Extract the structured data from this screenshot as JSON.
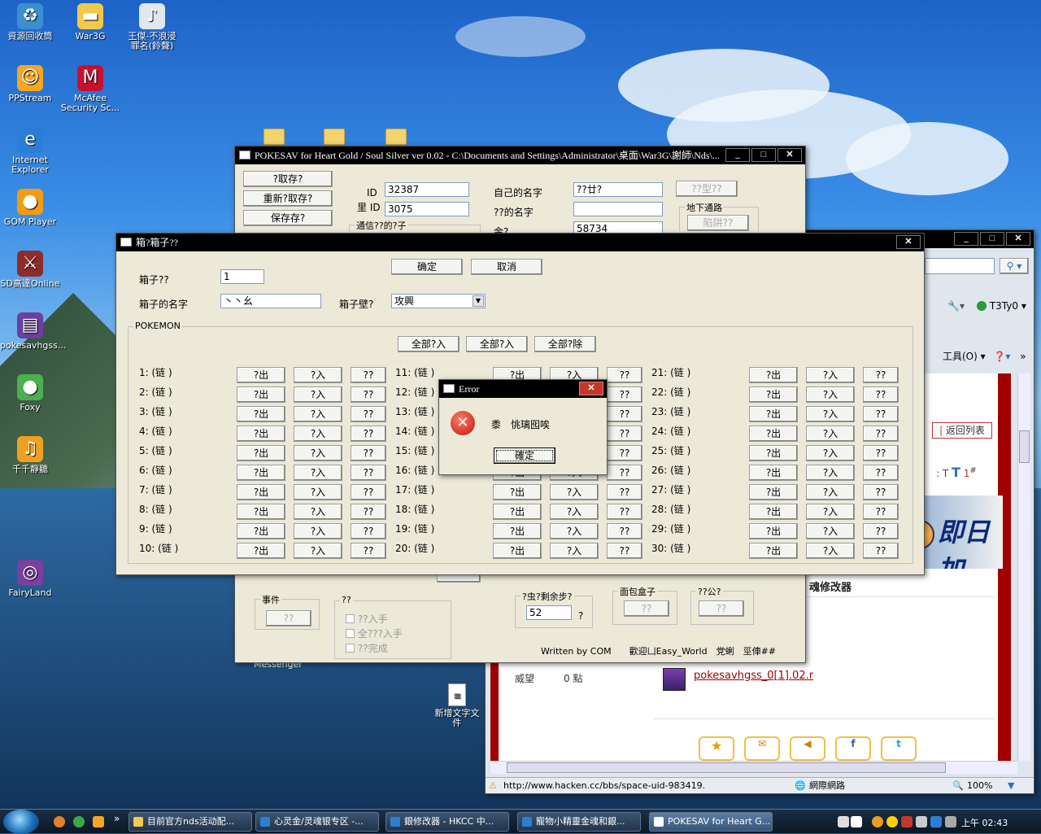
{
  "desktop": {
    "icons": [
      {
        "label": "資源回收筒",
        "icon": "recycle-bin-icon",
        "color": "#3a8fd0",
        "glyph": "♻"
      },
      {
        "label": "War3G",
        "icon": "folder-icon",
        "color": "#f3c94b",
        "glyph": "▬"
      },
      {
        "label": "王傑-不浪浸\n罪名(鈴聲)",
        "icon": "mp3-file-icon",
        "color": "#dfe8f0",
        "glyph": "♪"
      },
      {
        "label": "PPStream",
        "icon": "ppstream-icon",
        "color": "#f5a623",
        "glyph": "☺"
      },
      {
        "label": "McAfee\nSecurity Sc...",
        "icon": "mcafee-icon",
        "color": "#c8102e",
        "glyph": "M"
      },
      {
        "label": "Internet\nExplorer",
        "icon": "ie-icon",
        "color": "#2a7fd4",
        "glyph": "e"
      },
      {
        "label": "GOM Player",
        "icon": "gom-player-icon",
        "color": "#f39c12",
        "glyph": "●"
      },
      {
        "label": "SD高達Online",
        "icon": "sd-gundam-icon",
        "color": "#8e2b2b",
        "glyph": "⚔"
      },
      {
        "label": "pokesavhgss...",
        "icon": "winrar-archive-icon",
        "color": "#6a3fa0",
        "glyph": "▤"
      },
      {
        "label": "Foxy",
        "icon": "foxy-icon",
        "color": "#4caf50",
        "glyph": "●"
      },
      {
        "label": "千千靜聽",
        "icon": "ttplayer-icon",
        "color": "#f0a020",
        "glyph": "♫"
      },
      {
        "label": "FairyLand",
        "icon": "fairyland-icon",
        "color": "#7b3fa0",
        "glyph": "◎"
      }
    ],
    "notepad_label": "新增文字文\n件",
    "messenger_label": "Messenger"
  },
  "pokesav": {
    "title": "POKESAV for Heart Gold / Soul Silver ver 0.02 - C:\\Documents and Settings\\Administrator\\桌面\\War3G\\謝師\\Nds\\...",
    "buttons": {
      "read": "?取存?",
      "reread": "重新?取存?",
      "save": "保存存?"
    },
    "id_label": "ID",
    "id_value": "32387",
    "secret_id_label": "里 ID",
    "secret_id_value": "3075",
    "comm_label": "通信??的?子",
    "own_name_label": "自己的名字",
    "own_name_value": "??廿?",
    "rival_name_label": "??的名字",
    "rival_name_value": "",
    "money_label": "金?",
    "money_value": "58734",
    "type_btn": "??型??",
    "underground_label": "地下通路",
    "underground_btn": "陷阱??",
    "event_label": "事件",
    "event_btn": "??",
    "misc_label": "??",
    "checks": [
      "??入手",
      "全???入手",
      "??完成"
    ],
    "steps_label": "?虫?剩余步?",
    "steps_value": "52",
    "steps_q": "?",
    "bread_label": "面包盒子",
    "bread_btn": "??",
    "park_label": "??公?",
    "park_btn": "??",
    "credits": "Written by COM　　歡迎凵Easy_World　党蜊　巠俥##"
  },
  "box_dialog": {
    "title": "箱?箱子??",
    "ok": "确定",
    "cancel": "取消",
    "box_label": "箱子??",
    "box_value": "1",
    "box_name_label": "箱子的名字",
    "box_name_value": "丶丶幺",
    "wallpaper_label": "箱子壁?",
    "wallpaper_value": "攻興",
    "pokemon_group": "POKEMON",
    "all_out": "全部?入",
    "all_in": "全部?入",
    "all_del": "全部?除",
    "slot_prefix": "(链",
    "slot_suffix": ")",
    "btn_out": "?出",
    "btn_in": "?入",
    "btn_q": "??",
    "slots": [
      "1:",
      "2:",
      "3:",
      "4:",
      "5:",
      "6:",
      "7:",
      "8:",
      "9:",
      "10:",
      "11:",
      "12:",
      "13:",
      "14:",
      "15:",
      "16:",
      "17:",
      "18:",
      "19:",
      "20:",
      "21:",
      "22:",
      "23:",
      "24:",
      "25:",
      "26:",
      "27:",
      "28:",
      "29:",
      "30:"
    ]
  },
  "error": {
    "title": "Error",
    "message": "黍　恌璃囮唉",
    "ok": "確定"
  },
  "browser": {
    "tools_label": "工具(O)",
    "user": "T3Ty0",
    "back_list": "返回列表",
    "banner": "即日加",
    "heading": "魂修改器",
    "prestige_label": "威望",
    "prestige_value": "0 點",
    "attachment": "pokesavhgss_0[1].02.r",
    "status_url": "http://www.hacken.cc/bbs/space-uid-983419.",
    "zone": "網際網路",
    "zoom": "100%"
  },
  "taskbar": {
    "tasks": [
      {
        "label": "目前官方nds活动配...",
        "color": "#f3c94b"
      },
      {
        "label": "心灵金/灵魂银专区 -...",
        "color": "#2a7fd4"
      },
      {
        "label": "銀修改器 - HKCC 中...",
        "color": "#2a7fd4"
      },
      {
        "label": "寵物小精靈金魂和銀...",
        "color": "#2a7fd4"
      },
      {
        "label": "POKESAV for Heart G...",
        "color": "#ffffff"
      }
    ],
    "clock": "上午 02:43"
  }
}
